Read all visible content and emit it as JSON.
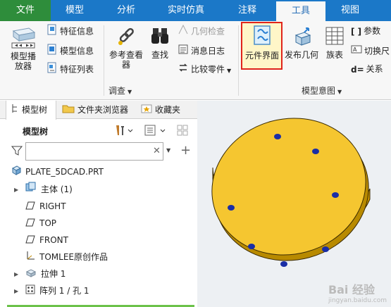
{
  "tabs": [
    {
      "label": "文件"
    },
    {
      "label": "模型"
    },
    {
      "label": "分析"
    },
    {
      "label": "实时仿真"
    },
    {
      "label": "注释"
    },
    {
      "label": "工具"
    },
    {
      "label": "视图"
    }
  ],
  "ribbon": {
    "model_player": "模型播放器",
    "feature_info": "特征信息",
    "model_info": "模型信息",
    "feature_list": "特征列表",
    "reference_viewer": "参考查看器",
    "find": "查找",
    "geometry_check": "几何检查",
    "message_log": "消息日志",
    "compare_parts": "比较零件",
    "investigate_group": "调查",
    "component_interface": "元件界面",
    "publish_geometry": "发布几何",
    "family_table": "族表",
    "parameters": "参数",
    "switch_dimensions": "切换尺",
    "relations": "关系",
    "model_intent_group": "模型意图"
  },
  "panel": {
    "tabs": [
      "模型树",
      "文件夹浏览器",
      "收藏夹"
    ],
    "tree_header": "模型树",
    "search_value": "",
    "items": [
      {
        "label": "PLATE_5DCAD.PRT"
      },
      {
        "label": "主体 (1)"
      },
      {
        "label": "RIGHT"
      },
      {
        "label": "TOP"
      },
      {
        "label": "FRONT"
      },
      {
        "label": "TOMLEE原创作品"
      },
      {
        "label": "拉伸 1"
      },
      {
        "label": "阵列 1 / 孔 1"
      }
    ]
  },
  "viewport": {
    "watermark": "Bai 经验",
    "watermark_sub": "jingyan.baidu.com"
  },
  "colors": {
    "ribbon_blue": "#1b78c8",
    "file_tab_green": "#2e8d3b",
    "part_yellow": "#f4c430",
    "hole_blue": "#1a2ea6",
    "highlight_red": "#e0241b"
  }
}
